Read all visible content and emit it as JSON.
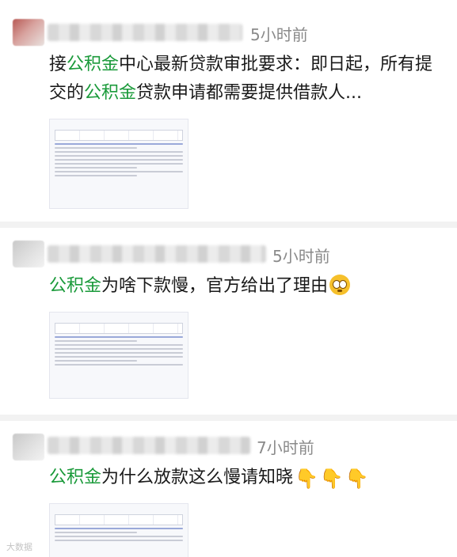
{
  "posts": [
    {
      "time": "5小时前",
      "text_prefix": "接",
      "hl1": "公积金",
      "text_mid": "中心最新贷款审批要求：即日起，所有提交的",
      "hl2": "公积金",
      "text_suffix": "贷款申请都需要提供借款人..."
    },
    {
      "time": "5小时前",
      "hl1": "公积金",
      "text_suffix": "为啥下款慢，官方给出了理由"
    },
    {
      "time": "7小时前",
      "hl1": "公积金",
      "text_suffix": "为什么放款这么慢请知晓"
    }
  ],
  "icons": {
    "emoji_post2": "flushed-face-emoji-icon",
    "emoji_post3": "pointing-down-hand-icon"
  },
  "colors": {
    "highlight": "#1a9a3a",
    "time": "#8a8a8a",
    "separator": "#f2f2f2"
  },
  "watermark": "大数据"
}
